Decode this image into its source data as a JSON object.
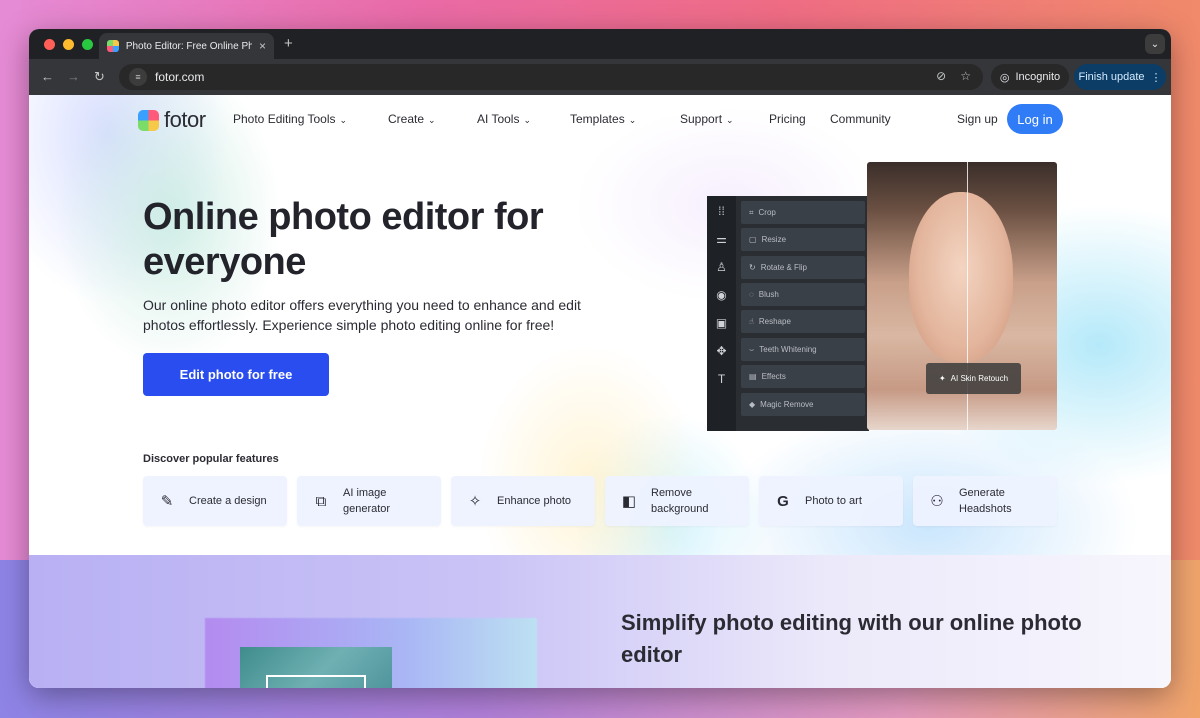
{
  "browser": {
    "tab_title": "Photo Editor: Free Online Pho",
    "tab_close": "×",
    "new_tab": "+",
    "tab_menu": "⌄",
    "url": "fotor.com",
    "incognito_label": "Incognito",
    "finish_update_label": "Finish update",
    "traffic_colors": [
      "#ff5f57",
      "#febc2e",
      "#28c840"
    ]
  },
  "nav": {
    "logo_text": "fotor",
    "items": [
      {
        "label": "Photo Editing Tools",
        "dropdown": true
      },
      {
        "label": "Create",
        "dropdown": true
      },
      {
        "label": "AI Tools",
        "dropdown": true
      },
      {
        "label": "Templates",
        "dropdown": true
      },
      {
        "label": "Support",
        "dropdown": true
      },
      {
        "label": "Pricing",
        "dropdown": false
      },
      {
        "label": "Community",
        "dropdown": false
      }
    ],
    "signup_label": "Sign up",
    "login_label": "Log in"
  },
  "hero": {
    "title": "Online photo editor for everyone",
    "subtitle": "Our online photo editor offers everything you need to enhance and edit photos effortlessly. Experience simple photo editing online for free!",
    "cta_label": "Edit photo for free"
  },
  "editor": {
    "tools": [
      "Crop",
      "Resize",
      "Rotate & Flip",
      "Blush",
      "Reshape",
      "Teeth Whitening",
      "Effects",
      "Magic Remove"
    ],
    "retouch_badge": "AI Skin Retouch"
  },
  "features": {
    "heading": "Discover popular features",
    "items": [
      {
        "label": "Create a design",
        "icon": "magic-pencil-icon"
      },
      {
        "label": "AI image generator",
        "icon": "ai-image-icon"
      },
      {
        "label": "Enhance photo",
        "icon": "sparkle-icon"
      },
      {
        "label": "Remove background",
        "icon": "cutout-icon"
      },
      {
        "label": "Photo to art",
        "icon": "art-icon"
      },
      {
        "label": "Generate Headshots",
        "icon": "user-plus-icon"
      }
    ]
  },
  "lower": {
    "title": "Simplify photo editing with our online photo editor"
  },
  "colors": {
    "accent_blue": "#2a4df0",
    "login_blue": "#2f7cf6"
  }
}
